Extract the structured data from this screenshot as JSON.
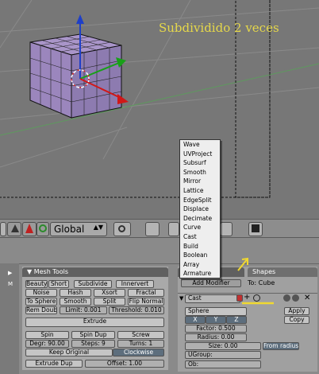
{
  "viewport": {
    "caption": "Subdividido 2 veces"
  },
  "header": {
    "transform_space": "Global"
  },
  "menu": {
    "items": [
      "Wave",
      "UVProject",
      "Subsurf",
      "Smooth",
      "Mirror",
      "Lattice",
      "EdgeSplit",
      "Displace",
      "Decimate",
      "Curve",
      "Cast",
      "Build",
      "Boolean",
      "Array",
      "Armature"
    ]
  },
  "mesh_tools": {
    "title": "Mesh Tools",
    "row1": [
      "Beauty",
      "Short",
      "Subdivide",
      "Innervert"
    ],
    "row2": [
      "Noise",
      "Hash",
      "Xsort",
      "Fractal"
    ],
    "row3": [
      "To Sphere",
      "Smooth",
      "Split",
      "Flip Normal"
    ],
    "row4": [
      "Rem Doubl",
      "Limit: 0.001",
      "Threshold: 0.010"
    ],
    "extrude": "Extrude",
    "row6": [
      "Spin",
      "Spin Dup",
      "Screw"
    ],
    "row7": [
      "Degr: 90.00",
      "Steps: 9",
      "Turns: 1"
    ],
    "keep_original": "Keep Original",
    "clockwise": "Clockwise",
    "extrude_dup": "Extrude Dup",
    "offset": "Offset: 1.00"
  },
  "modifiers": {
    "tab_shapes": "Shapes",
    "add_modifier": "Add Modifier",
    "to": "To: Cube",
    "name": "Cast",
    "cast_type": "Sphere",
    "axes": [
      "X",
      "Y",
      "Z"
    ],
    "factor": "Factor: 0.500",
    "radius": "Radius: 0.00",
    "size": "Size: 0.00",
    "from_radius": "From radius",
    "ugroup": "UGroup:",
    "ob": "Ob:",
    "apply": "Apply",
    "copy": "Copy"
  },
  "colors": {
    "accent_yellow": "#e6d84a",
    "menu_bg": "#eeeeee",
    "cube": "#9b86bd"
  }
}
